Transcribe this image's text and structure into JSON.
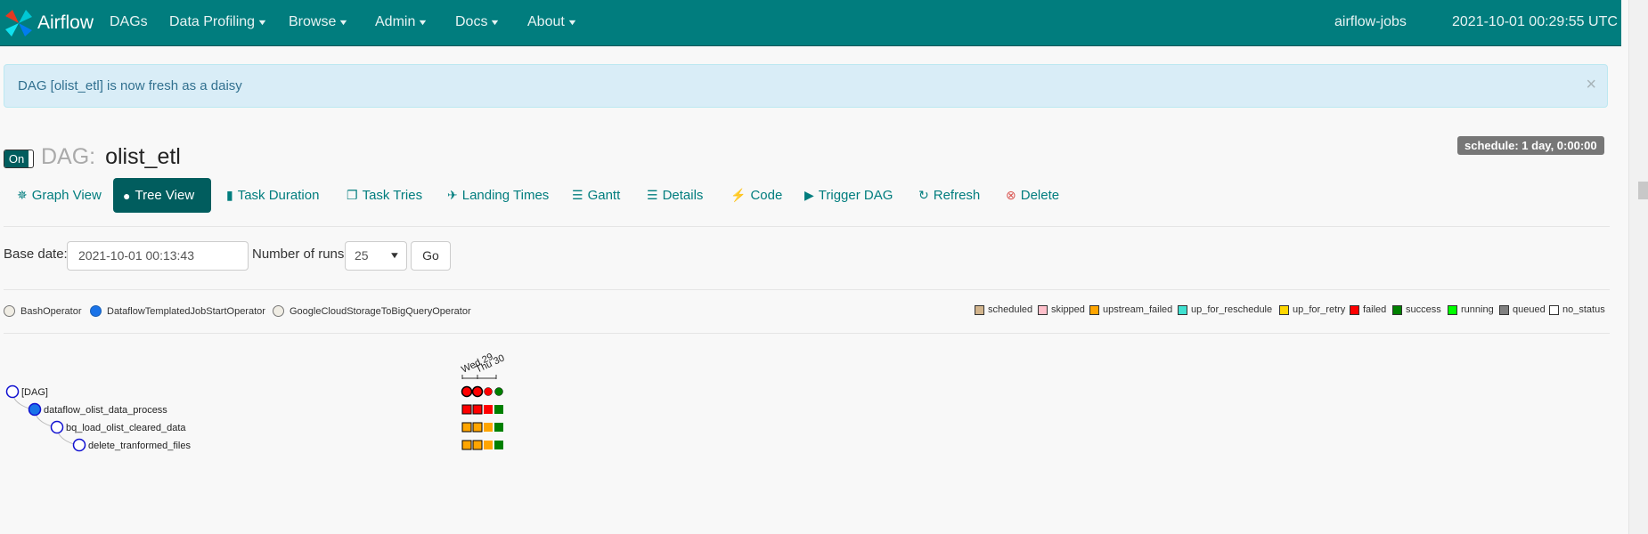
{
  "navbar": {
    "brand": "Airflow",
    "items": [
      {
        "label": "DAGs",
        "dropdown": false
      },
      {
        "label": "Data Profiling",
        "dropdown": true
      },
      {
        "label": "Browse",
        "dropdown": true
      },
      {
        "label": "Admin",
        "dropdown": true
      },
      {
        "label": "Docs",
        "dropdown": true
      },
      {
        "label": "About",
        "dropdown": true
      }
    ],
    "hostname": "airflow-jobs",
    "clock": "2021-10-01 00:29:55 UTC"
  },
  "alert": {
    "message": "DAG [olist_etl] is now fresh as a daisy",
    "close": "×"
  },
  "dag": {
    "toggle_label": "On",
    "prefix": "DAG:",
    "name": "olist_etl",
    "schedule": "schedule: 1 day, 0:00:00"
  },
  "tabs": [
    {
      "label": "Graph View",
      "icon": "graph-icon",
      "active": false
    },
    {
      "label": "Tree View",
      "icon": "tree-icon",
      "active": true
    },
    {
      "label": "Task Duration",
      "icon": "bar-chart-icon",
      "active": false
    },
    {
      "label": "Task Tries",
      "icon": "duplicate-icon",
      "active": false
    },
    {
      "label": "Landing Times",
      "icon": "plane-icon",
      "active": false
    },
    {
      "label": "Gantt",
      "icon": "gantt-icon",
      "active": false
    },
    {
      "label": "Details",
      "icon": "list-icon",
      "active": false
    },
    {
      "label": "Code",
      "icon": "flash-icon",
      "active": false
    },
    {
      "label": "Trigger DAG",
      "icon": "play-circle-icon",
      "active": false
    },
    {
      "label": "Refresh",
      "icon": "refresh-icon",
      "active": false
    },
    {
      "label": "Delete",
      "icon": "remove-circle-icon",
      "active": false
    }
  ],
  "form": {
    "base_date_label": "Base date:",
    "base_date_value": "2021-10-01 00:13:43",
    "runs_label": "Number of runs:",
    "runs_value": "25",
    "go_label": "Go"
  },
  "operators": [
    {
      "label": "BashOperator",
      "color": "#f0ede4"
    },
    {
      "label": "DataflowTemplatedJobStartOperator",
      "color": "#1a73e8"
    },
    {
      "label": "GoogleCloudStorageToBigQueryOperator",
      "color": "#f0ede4"
    }
  ],
  "states": [
    {
      "label": "scheduled",
      "color": "#d2b48c"
    },
    {
      "label": "skipped",
      "color": "#ffc0cb"
    },
    {
      "label": "upstream_failed",
      "color": "#ffa500"
    },
    {
      "label": "up_for_reschedule",
      "color": "#40e0d0"
    },
    {
      "label": "up_for_retry",
      "color": "#ffd700"
    },
    {
      "label": "failed",
      "color": "#ff0000"
    },
    {
      "label": "success",
      "color": "#008000"
    },
    {
      "label": "running",
      "color": "#00ff00"
    },
    {
      "label": "queued",
      "color": "#808080"
    },
    {
      "label": "no_status",
      "color": "#ffffff"
    }
  ],
  "tree": {
    "date_labels": [
      "Wed 29",
      "Thu 30"
    ],
    "nodes": [
      {
        "label": "[DAG]",
        "fill": "#ffffff",
        "depth": 0
      },
      {
        "label": "dataflow_olist_data_process",
        "fill": "#1a73e8",
        "depth": 1
      },
      {
        "label": "bq_load_olist_cleared_data",
        "fill": "#ffffff",
        "depth": 2
      },
      {
        "label": "delete_tranformed_files",
        "fill": "#ffffff",
        "depth": 3
      }
    ],
    "run_states": [
      "failed",
      "failed",
      "failed",
      "success"
    ],
    "task_states": [
      [
        "failed",
        "failed",
        "failed",
        "success"
      ],
      [
        "upstream_failed",
        "upstream_failed",
        "upstream_failed",
        "success"
      ],
      [
        "upstream_failed",
        "upstream_failed",
        "upstream_failed",
        "success"
      ]
    ]
  }
}
